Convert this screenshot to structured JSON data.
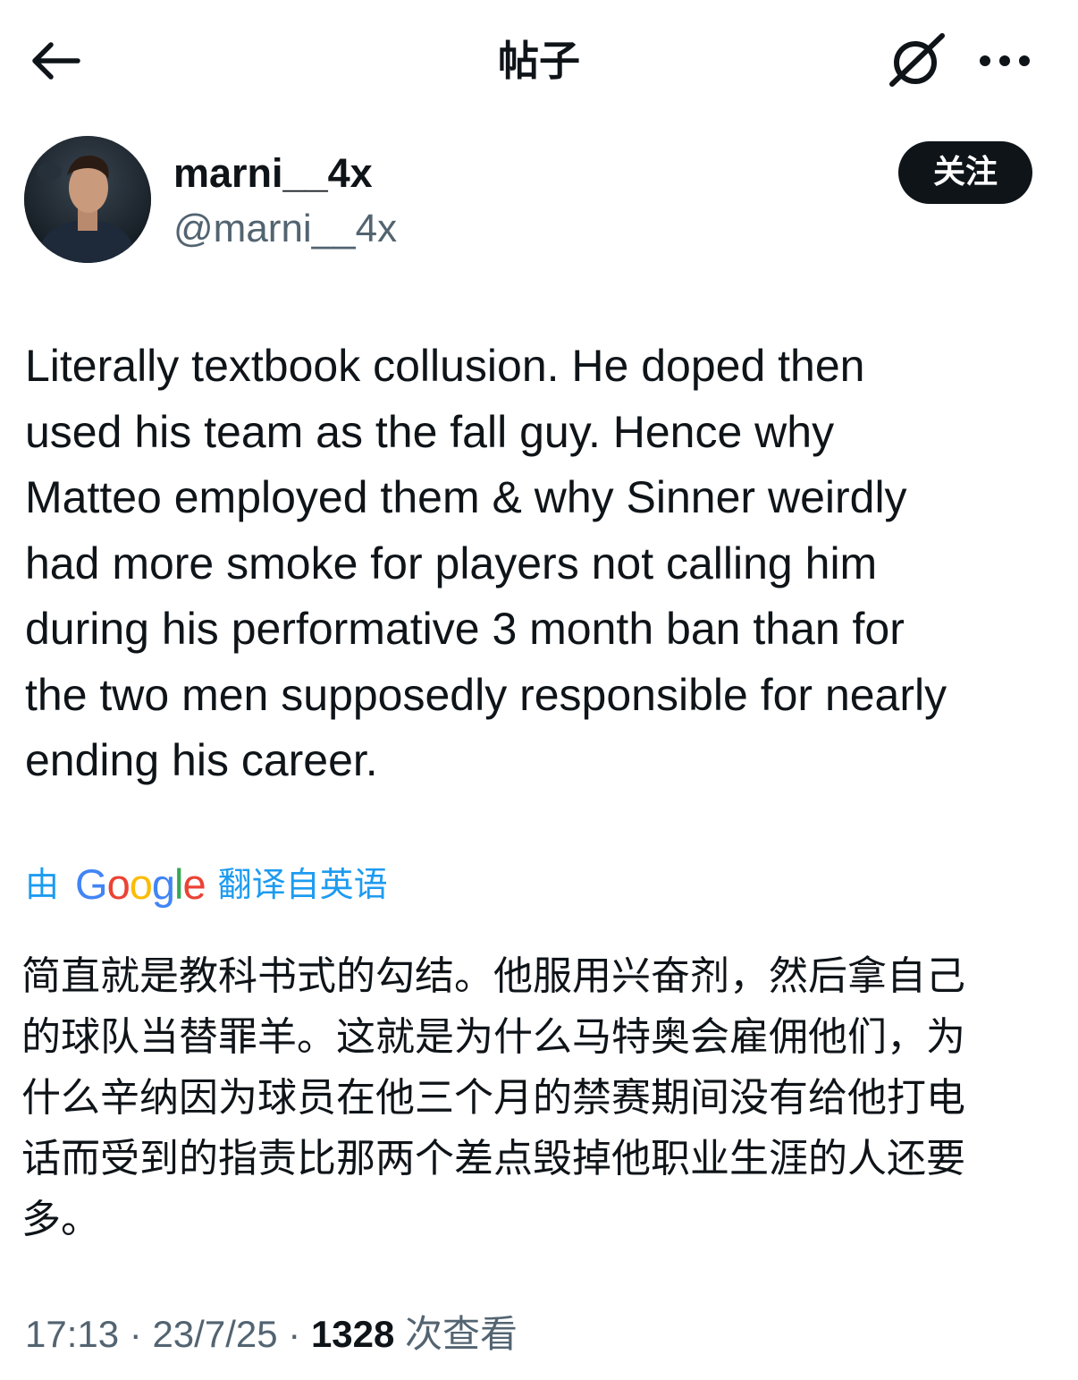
{
  "header": {
    "title": "帖子",
    "back_icon": "arrow-left-icon",
    "grok_icon": "grok-icon",
    "more_icon": "more-horizontal-icon"
  },
  "author": {
    "display_name": "marni__4x",
    "handle": "@marni__4x",
    "follow_label": "关注"
  },
  "post": {
    "lines": [
      "Literally textbook collusion. He doped then",
      "used his team as the fall guy. Hence why",
      "Matteo employed them & why Sinner weirdly",
      "had more smoke for players not calling him",
      "during his performative 3 month ban than for",
      "the two men supposedly responsible for nearly",
      "ending his career."
    ]
  },
  "translation": {
    "prefix": "由",
    "provider": "Google",
    "suffix": "翻译自英语",
    "lines": [
      "简直就是教科书式的勾结。他服用兴奋剂，然后拿自己",
      "的球队当替罪羊。这就是为什么马特奥会雇佣他们，为",
      "什么辛纳因为球员在他三个月的禁赛期间没有给他打电",
      "话而受到的指责比那两个差点毁掉他职业生涯的人还要",
      "多。"
    ]
  },
  "meta": {
    "time": "17:13",
    "separator": "·",
    "date": "23/7/25",
    "views_count": "1328",
    "views_label": "次查看"
  },
  "colors": {
    "text": "#0f1419",
    "secondary": "#536471",
    "link": "#1d9bf0",
    "google_blue": "#4285f4",
    "google_red": "#ea4335",
    "google_yellow": "#fbbc05",
    "google_green": "#34a853"
  }
}
